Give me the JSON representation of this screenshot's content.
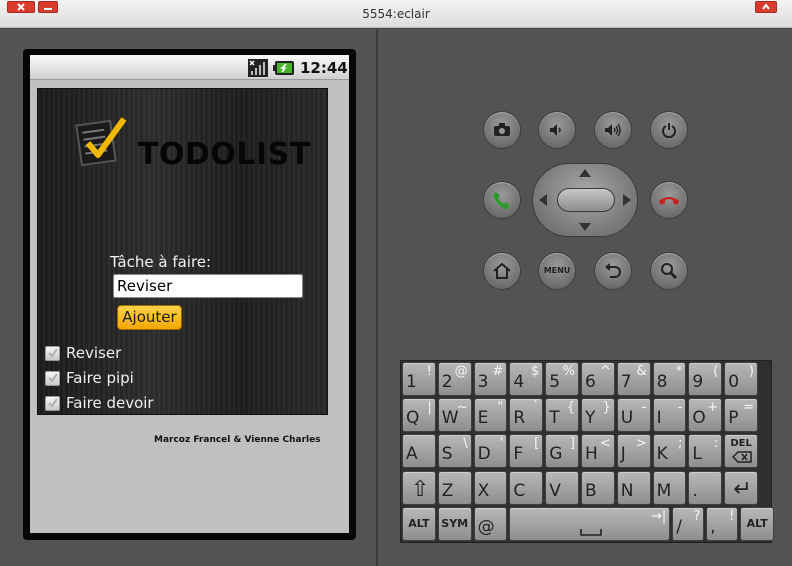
{
  "window": {
    "title": "5554:eclair"
  },
  "status_bar": {
    "time": "12:44"
  },
  "app": {
    "title": "TODOLIST",
    "task_label": "Tâche à faire:",
    "task_input_value": "Reviser",
    "add_button": "Ajouter",
    "todos": [
      {
        "label": "Reviser",
        "checked": false
      },
      {
        "label": "Faire pipi",
        "checked": false
      },
      {
        "label": "Faire devoir",
        "checked": false
      }
    ],
    "credit": "Marcoz Francel & Vienne Charles"
  },
  "controls": {
    "menu_label": "MENU",
    "buttons": [
      "camera-icon",
      "volume-down-icon",
      "volume-up-icon",
      "power-icon",
      "call-icon",
      "end-call-icon",
      "home-icon",
      "menu-button",
      "back-icon",
      "search-icon"
    ]
  },
  "keyboard": {
    "rows": [
      [
        {
          "main": "1",
          "alt": "!"
        },
        {
          "main": "2",
          "alt": "@"
        },
        {
          "main": "3",
          "alt": "#"
        },
        {
          "main": "4",
          "alt": "$"
        },
        {
          "main": "5",
          "alt": "%"
        },
        {
          "main": "6",
          "alt": "^"
        },
        {
          "main": "7",
          "alt": "&"
        },
        {
          "main": "8",
          "alt": "*"
        },
        {
          "main": "9",
          "alt": "("
        },
        {
          "main": "0",
          "alt": ")"
        }
      ],
      [
        {
          "main": "Q",
          "alt": "|"
        },
        {
          "main": "W",
          "alt": "~"
        },
        {
          "main": "E",
          "alt": "\""
        },
        {
          "main": "R",
          "alt": "`"
        },
        {
          "main": "T",
          "alt": "{"
        },
        {
          "main": "Y",
          "alt": "}"
        },
        {
          "main": "U",
          "alt": "-"
        },
        {
          "main": "I",
          "alt": "-"
        },
        {
          "main": "O",
          "alt": "+"
        },
        {
          "main": "P",
          "alt": "="
        }
      ],
      [
        {
          "main": "A",
          "alt": ""
        },
        {
          "main": "S",
          "alt": "\\"
        },
        {
          "main": "D",
          "alt": "'"
        },
        {
          "main": "F",
          "alt": "["
        },
        {
          "main": "G",
          "alt": "]"
        },
        {
          "main": "H",
          "alt": "<"
        },
        {
          "main": "J",
          "alt": ">"
        },
        {
          "main": "K",
          "alt": ";"
        },
        {
          "main": "L",
          "alt": ":"
        },
        {
          "main": "DEL",
          "alt": ""
        }
      ],
      [
        {
          "main": "⇧",
          "alt": ""
        },
        {
          "main": "Z",
          "alt": ""
        },
        {
          "main": "X",
          "alt": ""
        },
        {
          "main": "C",
          "alt": ""
        },
        {
          "main": "V",
          "alt": ""
        },
        {
          "main": "B",
          "alt": ""
        },
        {
          "main": "N",
          "alt": ""
        },
        {
          "main": "M",
          "alt": ""
        },
        {
          "main": ".",
          "alt": ""
        },
        {
          "main": "↵",
          "alt": ""
        }
      ],
      [
        {
          "main": "ALT",
          "alt": ""
        },
        {
          "main": "SYM",
          "alt": ""
        },
        {
          "main": "@",
          "alt": ""
        },
        {
          "main": "␣",
          "alt": "→|"
        },
        {
          "main": "/",
          "alt": "?"
        },
        {
          "main": ",",
          "alt": "!"
        },
        {
          "main": "ALT",
          "alt": ""
        }
      ]
    ]
  },
  "colors": {
    "accent_button": "#f5a700",
    "call_green": "#2e9a2e",
    "end_call_red": "#c8201a",
    "window_close": "#d93b2c"
  }
}
